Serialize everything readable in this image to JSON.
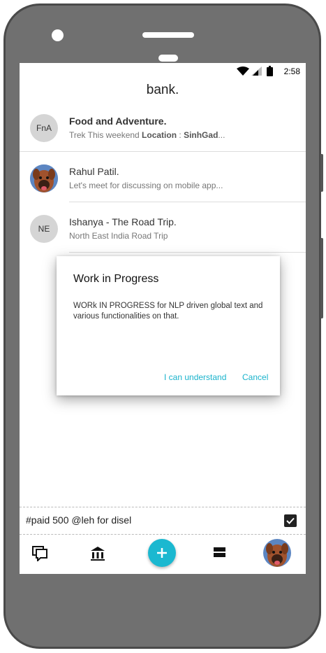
{
  "status_bar": {
    "time": "2:58"
  },
  "app": {
    "title": "bank."
  },
  "conversations": [
    {
      "avatar_text": "FnA",
      "title": "Food and Adventure.",
      "subtitle_prefix": "Trek This weekend ",
      "subtitle_bold_1": "Location",
      "subtitle_mid": " : ",
      "subtitle_bold_2": "SinhGad",
      "subtitle_suffix": "..."
    },
    {
      "avatar_text": "",
      "title": "Rahul Patil.",
      "subtitle": "Let's meet for discussing on mobile app..."
    },
    {
      "avatar_text": "NE",
      "title": "Ishanya - The Road Trip.",
      "subtitle": "North East India Road Trip"
    }
  ],
  "dialog": {
    "title": "Work in Progress",
    "body": "WORk IN PROGRESS for NLP driven global text and various functionalities on that.",
    "confirm_label": "I can understand",
    "cancel_label": "Cancel"
  },
  "compose": {
    "value": "#paid 500 @leh for disel"
  },
  "bottom_nav": {
    "items": [
      "chat-icon",
      "bank-icon",
      "add-icon",
      "list-icon",
      "profile-avatar"
    ]
  },
  "colors": {
    "accent": "#1bb8d0",
    "phone_body": "#707070"
  }
}
